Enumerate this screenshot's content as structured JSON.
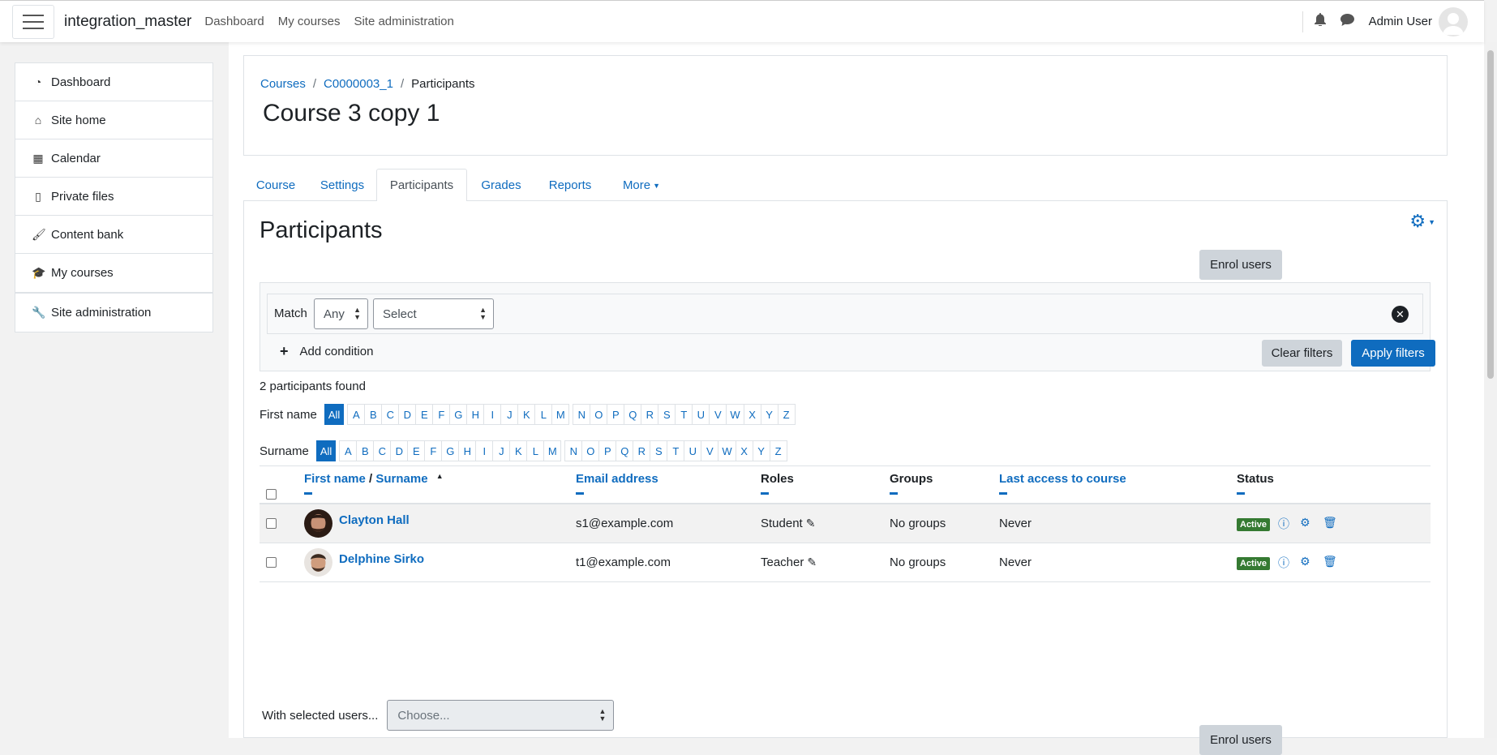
{
  "topbar": {
    "site_name": "integration_master",
    "nav": [
      "Dashboard",
      "My courses",
      "Site administration"
    ],
    "user_name": "Admin User"
  },
  "sidebar": {
    "items": [
      {
        "label": "Dashboard",
        "icon": "dashboard-icon"
      },
      {
        "label": "Site home",
        "icon": "home-icon"
      },
      {
        "label": "Calendar",
        "icon": "calendar-icon"
      },
      {
        "label": "Private files",
        "icon": "file-icon"
      },
      {
        "label": "Content bank",
        "icon": "brush-icon"
      },
      {
        "label": "My courses",
        "icon": "graduation-cap-icon"
      }
    ],
    "admin": {
      "label": "Site administration",
      "icon": "wrench-icon"
    }
  },
  "breadcrumb": {
    "items": [
      "Courses",
      "C0000003_1",
      "Participants"
    ],
    "sep": "/"
  },
  "page_title": "Course 3 copy 1",
  "tabs": [
    "Course",
    "Settings",
    "Participants",
    "Grades",
    "Reports",
    "More"
  ],
  "participants": {
    "heading": "Participants",
    "enrol_label": "Enrol users",
    "filter": {
      "match_label": "Match",
      "match_value": "Any",
      "select_value": "Select",
      "add_condition": "Add condition",
      "clear": "Clear filters",
      "apply": "Apply filters"
    },
    "found": "2 participants found",
    "firstname_label": "First name",
    "surname_label": "Surname",
    "letters": [
      "All",
      "A",
      "B",
      "C",
      "D",
      "E",
      "F",
      "G",
      "H",
      "I",
      "J",
      "K",
      "L",
      "M",
      "N",
      "O",
      "P",
      "Q",
      "R",
      "S",
      "T",
      "U",
      "V",
      "W",
      "X",
      "Y",
      "Z"
    ],
    "columns": {
      "firstname": "First name",
      "slash": "/",
      "surname": "Surname",
      "email": "Email address",
      "roles": "Roles",
      "groups": "Groups",
      "last_access": "Last access to course",
      "status": "Status"
    },
    "rows": [
      {
        "name": "Clayton Hall",
        "email": "s1@example.com",
        "role": "Student",
        "groups": "No groups",
        "last_access": "Never",
        "status": "Active"
      },
      {
        "name": "Delphine Sirko",
        "email": "t1@example.com",
        "role": "Teacher",
        "groups": "No groups",
        "last_access": "Never",
        "status": "Active"
      }
    ],
    "with_selected": "With selected users...",
    "choose": "Choose..."
  },
  "colors": {
    "link": "#0f6cbf",
    "active_badge": "#357a32",
    "secondary_btn": "#ced4da"
  }
}
